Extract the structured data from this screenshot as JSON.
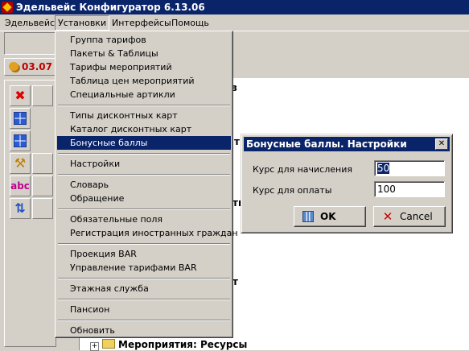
{
  "window": {
    "title": "Эдельвейс Конфигуратор 6.13.06"
  },
  "menubar": [
    "Эдельвейс",
    "Установки",
    "Интерфейсы",
    "Помощь"
  ],
  "date_text": "03.07",
  "tree": {
    "fragment1": "з",
    "fragment2": "т",
    "fragment3": "ть",
    "fragment4": "т",
    "last_item": "Мероприятия: Ресурсы"
  },
  "dropdown": {
    "items": [
      "Группа тарифов",
      "Пакеты & Таблицы",
      "Тарифы мероприятий",
      "Таблица цен мероприятий",
      "Специальные артикли",
      "Типы дисконтных карт",
      "Каталог дисконтных карт",
      "Бонусные баллы",
      "Настройки",
      "Словарь",
      "Обращение",
      "Обязательные поля",
      "Регистрация иностранных граждан",
      "Проекция BAR",
      "Управление тарифами BAR",
      "Этажная служба",
      "Пансион",
      "Обновить"
    ],
    "selected": "Бонусные баллы"
  },
  "dialog": {
    "title": "Бонусные баллы. Настройки",
    "accrual_label": "Курс для начисления",
    "accrual_value": "50",
    "payment_label": "Курс для оплаты",
    "payment_value": "100",
    "ok_label": "OK",
    "cancel_label": "Cancel"
  },
  "colors": {
    "title_bar": "#0a246a",
    "selection": "#0a246a",
    "face": "#d4d0c8",
    "date_text": "#c00000"
  },
  "icons": [
    "delete-icon",
    "grid-icon",
    "tools-icon",
    "spellcheck-icon",
    "refresh-icon",
    "calculator-icon",
    "cancel-x-icon",
    "close-icon"
  ]
}
